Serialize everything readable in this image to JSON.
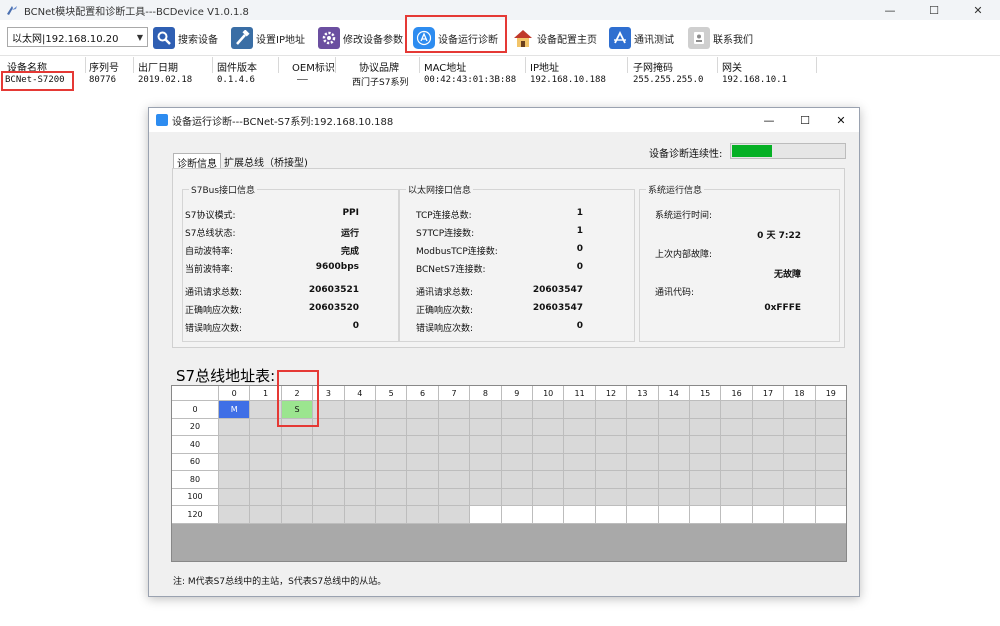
{
  "window": {
    "title": "BCNet模块配置和诊断工具---BCDevice V1.0.1.8",
    "controls": [
      "—",
      "☐",
      "✕"
    ]
  },
  "toolbar": {
    "adapter_value": "以太网|192.168.10.20",
    "buttons": [
      {
        "label": "搜索设备",
        "icon": "search-icon",
        "color": "#2f5fb3"
      },
      {
        "label": "设置IP地址",
        "icon": "hammer-icon",
        "color": "#3a6ea5"
      },
      {
        "label": "修改设备参数",
        "icon": "gear-icon",
        "color": "#6b4fa0"
      },
      {
        "label": "设备运行诊断",
        "icon": "appstore-icon",
        "color": "#2d8cf0"
      },
      {
        "label": "设备配置主页",
        "icon": "home-icon",
        "color": "#c0392b"
      },
      {
        "label": "通讯测试",
        "icon": "triangle-icon",
        "color": "#2f6fd0"
      },
      {
        "label": "联系我们",
        "icon": "contact-icon",
        "color": "#8c8c8c"
      }
    ]
  },
  "device_list": {
    "headers": [
      "设备名称",
      "序列号",
      "出厂日期",
      "固件版本",
      "OEM标识",
      "协议品牌",
      "MAC地址",
      "IP地址",
      "子网掩码",
      "网关"
    ],
    "row": [
      "BCNet-S7200",
      "80776",
      "2019.02.18",
      "0.1.4.6",
      "——",
      "西门子S7系列",
      "00:42:43:01:3B:88",
      "192.168.10.188",
      "255.255.255.0",
      "192.168.10.1"
    ]
  },
  "dialog": {
    "title": "设备运行诊断---BCNet-S7系列:192.168.10.188",
    "controls": [
      "—",
      "☐",
      "✕"
    ],
    "tabs": [
      "诊断信息",
      "扩展总线（桥接型)"
    ],
    "continuity_label": "设备诊断连续性:",
    "continuity_level": 0.36,
    "s7bus": {
      "title": "S7Bus接口信息",
      "rows": [
        {
          "label": "S7协议模式:",
          "value": "PPI"
        },
        {
          "label": "S7总线状态:",
          "value": "运行"
        },
        {
          "label": "自动波特率:",
          "value": "完成"
        },
        {
          "label": "当前波特率:",
          "value": "9600bps"
        },
        {
          "label": "通讯请求总数:",
          "value": "20603521"
        },
        {
          "label": "正确响应次数:",
          "value": "20603520"
        },
        {
          "label": "错误响应次数:",
          "value": "0"
        }
      ]
    },
    "ethernet": {
      "title": "以太网接口信息",
      "rows": [
        {
          "label": "TCP连接总数:",
          "value": "1"
        },
        {
          "label": "S7TCP连接数:",
          "value": "1"
        },
        {
          "label": "ModbusTCP连接数:",
          "value": "0"
        },
        {
          "label": "BCNetS7连接数:",
          "value": "0"
        },
        {
          "label": "通讯请求总数:",
          "value": "20603547"
        },
        {
          "label": "正确响应次数:",
          "value": "20603547"
        },
        {
          "label": "错误响应次数:",
          "value": "0"
        }
      ]
    },
    "system": {
      "title": "系统运行信息",
      "runtime_label": "系统运行时间:",
      "runtime_value": "0 天 7:22",
      "fault_label": "上次内部故障:",
      "fault_value": "无故障",
      "code_label": "通讯代码:",
      "code_value": "0xFFFE"
    },
    "address_table": {
      "title": "S7总线地址表:",
      "columns": [
        "0",
        "1",
        "2",
        "3",
        "4",
        "5",
        "6",
        "7",
        "8",
        "9",
        "10",
        "11",
        "12",
        "13",
        "14",
        "15",
        "16",
        "17",
        "18",
        "19"
      ],
      "rows": [
        "0",
        "20",
        "40",
        "60",
        "80",
        "100",
        "120"
      ],
      "master_label": "M",
      "slave_label": "S"
    },
    "note": "注: M代表S7总线中的主站，S代表S7总线中的从站。"
  }
}
